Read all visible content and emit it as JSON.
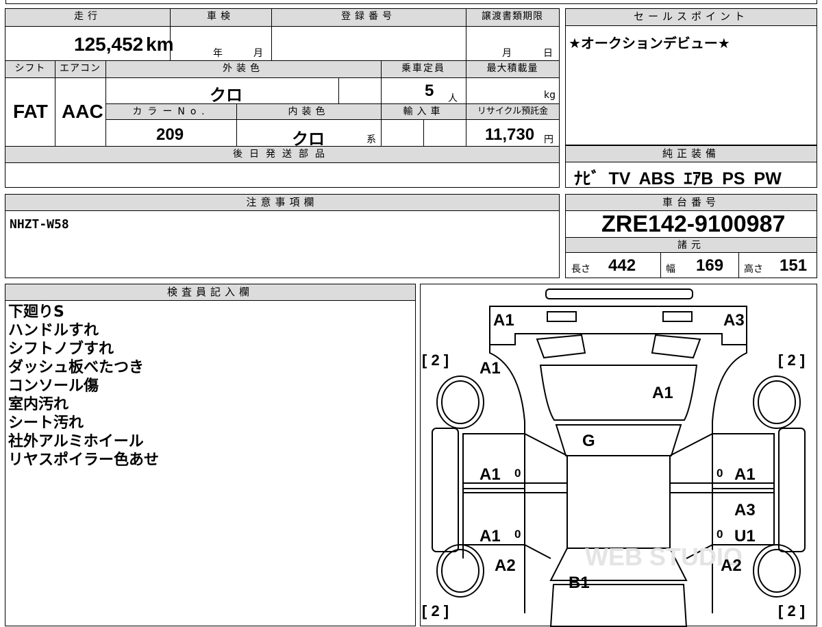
{
  "vehicle": {
    "mileage_label": "走行",
    "mileage": "125,452",
    "mileage_unit": "km",
    "inspection_label": "車検",
    "inspection_year_label": "年",
    "inspection_month_label": "月",
    "registration_label": "登録番号",
    "transfer_label": "譲渡書類期限",
    "transfer_month_label": "月",
    "transfer_day_label": "日",
    "shift_label": "シフト",
    "shift": "FAT",
    "aircon_label": "エアコン",
    "aircon": "AAC",
    "exterior_label": "外装色",
    "exterior": "クロ",
    "capacity_label": "乗車定員",
    "capacity": "5",
    "capacity_unit": "人",
    "maxload_label": "最大積載量",
    "maxload_unit": "kg",
    "color_no_label": "カラーNo.",
    "color_no": "209",
    "interior_label": "内装色",
    "interior": "クロ",
    "interior_suffix": "系",
    "import_label": "輸入車",
    "recycle_label": "リサイクル預託金",
    "recycle": "11,730",
    "recycle_unit": "円",
    "later_parts_label": "後日発送部品"
  },
  "sales_point": {
    "label": "セールスポイント",
    "text": "★オークションデビュー★"
  },
  "equipment": {
    "label": "純正装備",
    "items": [
      "ﾅﾋﾞ",
      "TV",
      "ABS",
      "ｴｱB",
      "PS",
      "PW"
    ]
  },
  "caution": {
    "label": "注意事項欄",
    "text": "NHZT-W58"
  },
  "chassis": {
    "label": "車台番号",
    "number": "ZRE142-9100987",
    "specs_label": "諸元",
    "length_label": "長さ",
    "length": "442",
    "width_label": "幅",
    "width": "169",
    "height_label": "高さ",
    "height": "151"
  },
  "inspector": {
    "label": "検査員記入欄",
    "notes": [
      "下廻りS",
      "ハンドルすれ",
      "シフトノブすれ",
      "ダッシュ板べたつき",
      "コンソール傷",
      "室内汚れ",
      "シート汚れ",
      "社外アルミホイール",
      "リヤスポイラー色あせ"
    ]
  },
  "diagram": {
    "watermark": "WEB STUDIO",
    "codes": {
      "front_left": "A1",
      "front_right": "A3",
      "fender_left": "A1",
      "hood": "A1",
      "windshield": "G",
      "front_door_left": "A1",
      "front_door_right": "A1",
      "rear_door_right_1": "A3",
      "rear_door_left": "A1",
      "rear_door_right_2": "U1",
      "quarter_left": "A2",
      "quarter_right": "A2",
      "trunk": "B1",
      "tire_fl": "[ 2 ]",
      "tire_fr": "[ 2 ]",
      "tire_rl": "[ 2 ]",
      "tire_rr": "[ 2 ]",
      "glass_mark_fl": "0",
      "glass_mark_fr": "0",
      "glass_mark_rl": "0",
      "glass_mark_rr": "0"
    }
  }
}
